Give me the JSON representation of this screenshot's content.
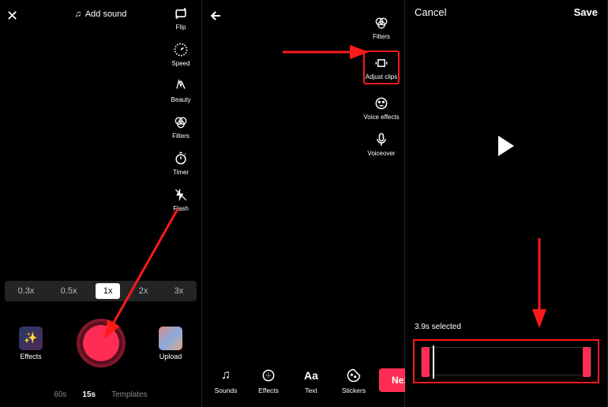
{
  "panel1": {
    "close": "✕",
    "add_sound": "Add sound",
    "side_tools": [
      {
        "label": "Flip"
      },
      {
        "label": "Speed"
      },
      {
        "label": "Beauty"
      },
      {
        "label": "Filters"
      },
      {
        "label": "Timer"
      },
      {
        "label": "Flash"
      }
    ],
    "speeds": [
      "0.3x",
      "0.5x",
      "1x",
      "2x",
      "3x"
    ],
    "speed_active": "1x",
    "effects_label": "Effects",
    "upload_label": "Upload",
    "modes": [
      "60s",
      "15s",
      "Templates"
    ],
    "mode_active": "15s"
  },
  "panel2": {
    "side_tools": [
      {
        "label": "Filters"
      },
      {
        "label": "Adjust clips"
      },
      {
        "label": "Voice effects"
      },
      {
        "label": "Voiceover"
      }
    ],
    "bottom_tools": [
      {
        "label": "Sounds"
      },
      {
        "label": "Effects"
      },
      {
        "label": "Text"
      },
      {
        "label": "Stickers"
      }
    ],
    "next": "Next"
  },
  "panel3": {
    "cancel": "Cancel",
    "save": "Save",
    "selected": "3.9s selected"
  }
}
